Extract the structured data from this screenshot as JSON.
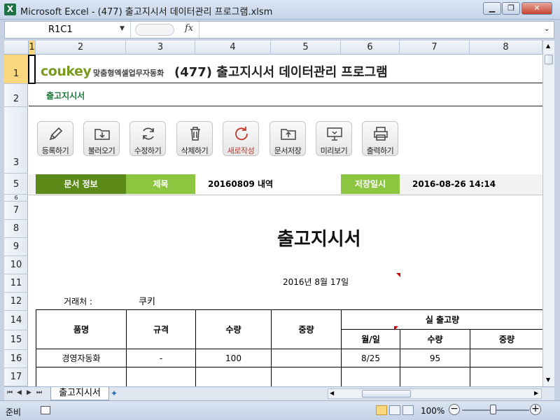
{
  "window": {
    "title": "Microsoft Excel - (477) 출고지시서 데이터관리 프로그램.xlsm",
    "app_icon": "X",
    "minimize": "▁",
    "restore": "❐",
    "close": "✕"
  },
  "formula_bar": {
    "name_box": "R1C1",
    "fx": "fx",
    "formula": ""
  },
  "columns": [
    "1",
    "2",
    "3",
    "4",
    "5",
    "6",
    "7",
    "8"
  ],
  "rows": [
    "1",
    "2",
    "3",
    "5",
    "6",
    "7",
    "8",
    "9",
    "10",
    "11",
    "12",
    "14",
    "15",
    "16",
    "17"
  ],
  "header": {
    "logo": "coukey",
    "tagline": "맞춤형엑셀업무자동화",
    "title": "(477) 출고지시서 데이터관리 프로그램",
    "subtitle": "출고지시서"
  },
  "toolbar": [
    {
      "label": "등록하기",
      "icon": "pencil-icon"
    },
    {
      "label": "불러오기",
      "icon": "download-folder-icon"
    },
    {
      "label": "수정하기",
      "icon": "refresh-icon"
    },
    {
      "label": "삭제하기",
      "icon": "trash-icon"
    },
    {
      "label": "새로작성",
      "icon": "new-cycle-icon"
    },
    {
      "label": "문서저장",
      "icon": "upload-folder-icon"
    },
    {
      "label": "미리보기",
      "icon": "monitor-icon"
    },
    {
      "label": "출력하기",
      "icon": "printer-icon"
    }
  ],
  "info": {
    "doc_label": "문서 정보",
    "title_label": "제목",
    "title_value": "20160809 내역",
    "date_label": "저장일시",
    "date_value": "2016-08-26 14:14"
  },
  "document": {
    "heading": "출고지시서",
    "date": "2016년 8월 17일",
    "client_label": "거래처 :",
    "client_value": "쿠키"
  },
  "table": {
    "headers": {
      "item": "품명",
      "spec": "규격",
      "qty": "수량",
      "weight": "중량",
      "actual": "실 출고량",
      "date": "월/일",
      "actual_qty": "수량",
      "actual_weight": "중량"
    },
    "rows": [
      {
        "item": "경영자동화",
        "spec": "-",
        "qty": "100",
        "weight": "",
        "date": "8/25",
        "actual_qty": "95",
        "actual_weight": ""
      },
      {
        "item": "",
        "spec": "",
        "qty": "",
        "weight": "",
        "date": "",
        "actual_qty": "",
        "actual_weight": ""
      }
    ]
  },
  "sheet_tabs": {
    "active": "출고지시서"
  },
  "status": {
    "mode": "준비",
    "zoom": "100%"
  },
  "colors": {
    "dark_green": "#5b8a18",
    "light_green": "#8cc540",
    "brand": "#7a9a1f"
  }
}
